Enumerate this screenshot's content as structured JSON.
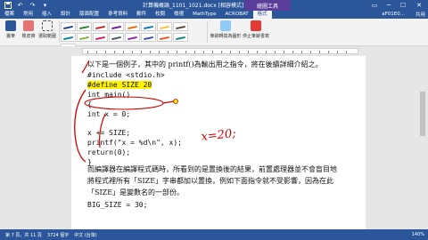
{
  "titlebar": {
    "doc_title": "計算機概論_1101_1021.docx [相容模式] - Word",
    "context_tab": "繪圖工具",
    "qat": {
      "save_icon": "save-icon",
      "undo_icon": "undo-icon",
      "redo_icon": "redo-icon"
    }
  },
  "ribbon": {
    "tabs": [
      "檔案",
      "常用",
      "插入",
      "設計",
      "版面配置",
      "參考資料",
      "郵件",
      "校閱",
      "檢視",
      "MathType",
      "ACROBAT",
      "格式"
    ],
    "active_tab": "格式",
    "user": "aF01E0...",
    "share": "共用",
    "buttons": {
      "pen": "畫筆",
      "eraser": "橡皮擦",
      "lasso": "選取範圍",
      "ink_to_shape": "筆跡轉換為圖形",
      "stop_inking": "停止筆跡書寫"
    },
    "pen_colors": [
      "#1f3d8a",
      "#2f7d32",
      "#c62828",
      "#6a1b9a",
      "#ef6c00",
      "#0277bd",
      "#fbc02d",
      "#5d4037",
      "#00838f",
      "#7cb342",
      "#d81b60",
      "#455a64",
      "#8e24aa",
      "#3949ab",
      "#f4511e",
      "#00897b",
      "#c0ca33"
    ]
  },
  "document": {
    "lines": [
      {
        "text": "以下是一個例子，其中的 printf()為輸出用之指令，將在後續詳細介紹之。",
        "style": "cjk"
      },
      {
        "text": "#include <stdio.h>",
        "style": "code"
      },
      {
        "text": "#define SIZE 20",
        "style": "code",
        "highlight": true
      },
      {
        "text": "int main()",
        "style": "code"
      },
      {
        "text": "{",
        "style": "code"
      },
      {
        "text": "  int x = 0;",
        "style": "code"
      },
      {
        "text": "",
        "style": "code"
      },
      {
        "text": "  x += SIZE;",
        "style": "code"
      },
      {
        "text": "  printf(\"x = %d\\n\", x);",
        "style": "code"
      },
      {
        "text": "  return(0);",
        "style": "code"
      },
      {
        "text": "}",
        "style": "code"
      },
      {
        "text": "而編譯器在編譯程式碼時，所看到的是置換後的結果，前置處理器並不會盲目地",
        "style": "cjk"
      },
      {
        "text": "將程式裡所有「SIZE」字串都加以置換，例如下面指令就不受影響，因為在此",
        "style": "cjk"
      },
      {
        "text": "「SIZE」是變數名的一部份。",
        "style": "cjk"
      },
      {
        "text": "BIG_SIZE = 30;",
        "style": "code"
      }
    ],
    "ink_note": "x=20;"
  },
  "statusbar": {
    "page": "第 7 頁，共 11 頁",
    "words": "3724 個字",
    "language": "中文 (台灣)",
    "zoom": "140%"
  }
}
